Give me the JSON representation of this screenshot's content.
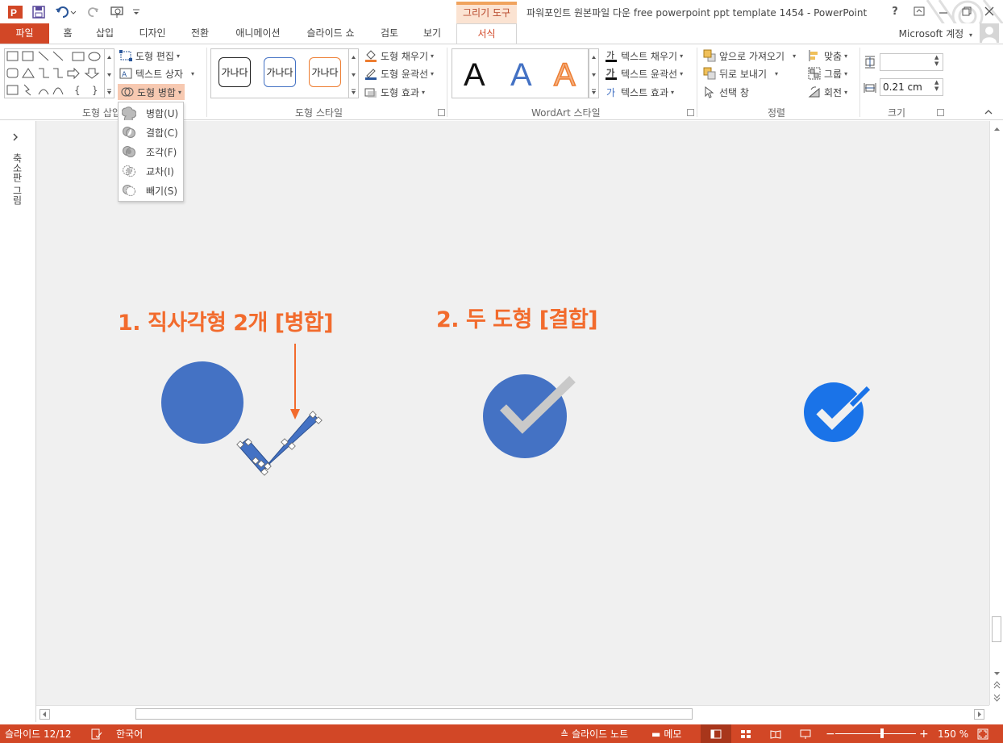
{
  "app": {
    "title": "파워포인트 원본파일 다운 free powerpoint ppt template 1454 - PowerPoint",
    "context_tab": "그리기 도구",
    "account": "Microsoft 계정"
  },
  "tabs": [
    {
      "label": "파일"
    },
    {
      "label": "홈"
    },
    {
      "label": "삽입"
    },
    {
      "label": "디자인"
    },
    {
      "label": "전환"
    },
    {
      "label": "애니메이션"
    },
    {
      "label": "슬라이드 쇼"
    },
    {
      "label": "검토"
    },
    {
      "label": "보기"
    },
    {
      "label": "서식"
    }
  ],
  "ribbon": {
    "insert_shapes": {
      "label": "도형 삽입",
      "edit_shape": "도형 편집",
      "text_box": "텍스트 상자",
      "merge_shapes": "도형 병합"
    },
    "shape_styles": {
      "label": "도형 스타일",
      "swatch_text": "가나다",
      "fill": "도형 채우기",
      "outline": "도형 윤곽선",
      "effects": "도형 효과"
    },
    "wordart": {
      "label": "WordArt 스타일",
      "letter": "A",
      "text_fill": "텍스트 채우기",
      "text_outline": "텍스트 윤곽선",
      "text_effects": "텍스트 효과"
    },
    "arrange": {
      "label": "정렬",
      "bring_forward": "앞으로 가져오기",
      "send_backward": "뒤로 보내기",
      "selection_pane": "선택 창",
      "align": "맞춤",
      "group": "그룹",
      "rotate": "회전"
    },
    "size": {
      "label": "크기",
      "height_value": "",
      "width_value": "0.21 cm"
    }
  },
  "merge_menu": {
    "items": [
      {
        "label": "병합(U)"
      },
      {
        "label": "결합(C)"
      },
      {
        "label": "조각(F)"
      },
      {
        "label": "교차(I)"
      },
      {
        "label": "빼기(S)"
      }
    ]
  },
  "thumbnails": {
    "label": "축소판 그림"
  },
  "slide": {
    "heading1": "1. 직사각형 2개 [병합]",
    "heading2": "2. 두 도형 [결합]",
    "colors": {
      "heading": "#f26b2d",
      "circle": "#4472c4",
      "check_gray": "#c9c9c9",
      "final_blue": "#1a73e8"
    }
  },
  "status": {
    "slide": "슬라이드 12/12",
    "language": "한국어",
    "notes": "슬라이드 노트",
    "comments": "메모",
    "zoom": "150 %"
  }
}
